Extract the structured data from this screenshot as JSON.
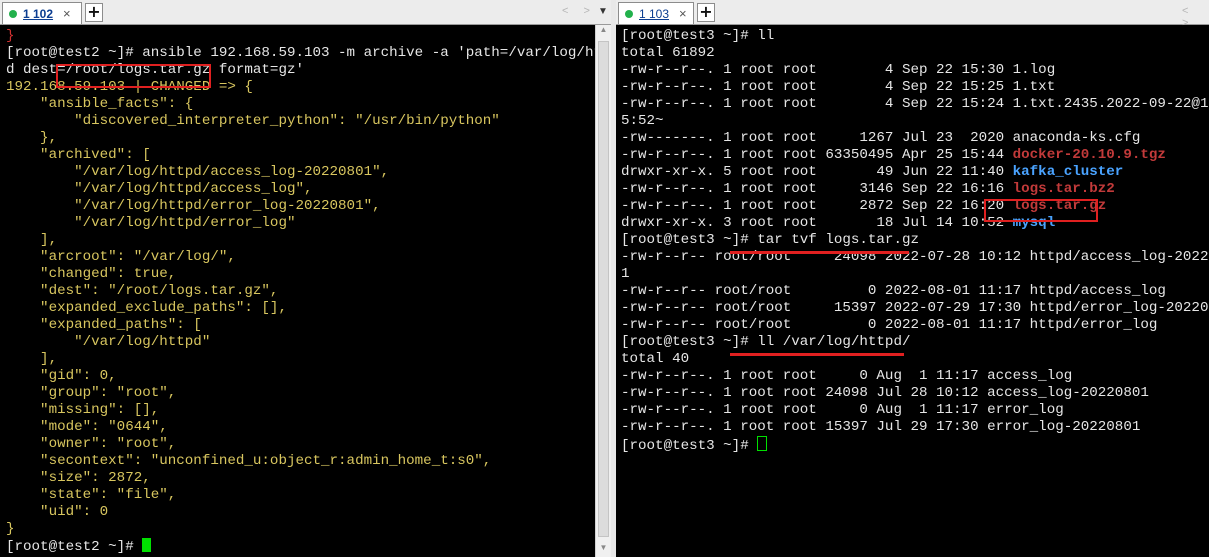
{
  "left": {
    "tab_label": "1 102",
    "tab_close": "×",
    "add_tab": "+",
    "nav_arrows": "< >",
    "menu_arrow": "▼",
    "lines": [
      [
        {
          "t": "}",
          "c": "r"
        }
      ],
      [
        {
          "t": "[root@test2 ~]# ansible 192.168.59.103 -m archive -a 'path=/var/log/http",
          "c": "w"
        }
      ],
      [
        {
          "t": "d dest=/root/logs.tar.gz format=gz'",
          "c": "w"
        }
      ],
      [
        {
          "t": "192.168.59.103 | CHANGED => {",
          "c": "y"
        }
      ],
      [
        {
          "t": "    \"ansible_facts\": {",
          "c": "y"
        }
      ],
      [
        {
          "t": "        \"discovered_interpreter_python\": \"/usr/bin/python\"",
          "c": "y"
        }
      ],
      [
        {
          "t": "    },",
          "c": "y"
        }
      ],
      [
        {
          "t": "    \"archived\": [",
          "c": "y"
        }
      ],
      [
        {
          "t": "        \"/var/log/httpd/access_log-20220801\",",
          "c": "y"
        }
      ],
      [
        {
          "t": "        \"/var/log/httpd/access_log\",",
          "c": "y"
        }
      ],
      [
        {
          "t": "        \"/var/log/httpd/error_log-20220801\",",
          "c": "y"
        }
      ],
      [
        {
          "t": "        \"/var/log/httpd/error_log\"",
          "c": "y"
        }
      ],
      [
        {
          "t": "    ],",
          "c": "y"
        }
      ],
      [
        {
          "t": "    \"arcroot\": \"/var/log/\",",
          "c": "y"
        }
      ],
      [
        {
          "t": "    \"changed\": true,",
          "c": "y"
        }
      ],
      [
        {
          "t": "    \"dest\": \"/root/logs.tar.gz\",",
          "c": "y"
        }
      ],
      [
        {
          "t": "    \"expanded_exclude_paths\": [],",
          "c": "y"
        }
      ],
      [
        {
          "t": "    \"expanded_paths\": [",
          "c": "y"
        }
      ],
      [
        {
          "t": "        \"/var/log/httpd\"",
          "c": "y"
        }
      ],
      [
        {
          "t": "    ],",
          "c": "y"
        }
      ],
      [
        {
          "t": "    \"gid\": 0,",
          "c": "y"
        }
      ],
      [
        {
          "t": "    \"group\": \"root\",",
          "c": "y"
        }
      ],
      [
        {
          "t": "    \"missing\": [],",
          "c": "y"
        }
      ],
      [
        {
          "t": "    \"mode\": \"0644\",",
          "c": "y"
        }
      ],
      [
        {
          "t": "    \"owner\": \"root\",",
          "c": "y"
        }
      ],
      [
        {
          "t": "    \"secontext\": \"unconfined_u:object_r:admin_home_t:s0\",",
          "c": "y"
        }
      ],
      [
        {
          "t": "    \"size\": 2872,",
          "c": "y"
        }
      ],
      [
        {
          "t": "    \"state\": \"file\",",
          "c": "y"
        }
      ],
      [
        {
          "t": "    \"uid\": 0",
          "c": "y"
        }
      ],
      [
        {
          "t": "}",
          "c": "y"
        }
      ],
      [
        {
          "t": "[root@test2 ~]# ",
          "c": "w"
        }
      ]
    ]
  },
  "right": {
    "tab_label": "1 103",
    "tab_close": "×",
    "add_tab": "+",
    "nav_arrows": "< >",
    "lines": [
      [
        {
          "t": "[root@test3 ~]# ll",
          "c": "w"
        }
      ],
      [
        {
          "t": "total 61892",
          "c": "w"
        }
      ],
      [
        {
          "t": "-rw-r--r--. 1 root root        4 Sep 22 15:30 1.log",
          "c": "w"
        }
      ],
      [
        {
          "t": "-rw-r--r--. 1 root root        4 Sep 22 15:25 1.txt",
          "c": "w"
        }
      ],
      [
        {
          "t": "-rw-r--r--. 1 root root        4 Sep 22 15:24 1.txt.2435.2022-09-22@15:2",
          "c": "w"
        }
      ],
      [
        {
          "t": "5:52~",
          "c": "w"
        }
      ],
      [
        {
          "t": "-rw-------. 1 root root     1267 Jul 23  2020 anaconda-ks.cfg",
          "c": "w"
        }
      ],
      [
        {
          "t": "-rw-r--r--. 1 root root 63350495 Apr 25 15:44 ",
          "c": "w"
        },
        {
          "t": "docker-20.10.9.tgz",
          "c": "db"
        }
      ],
      [
        {
          "t": "drwxr-xr-x. 5 root root       49 Jun 22 11:40 ",
          "c": "w"
        },
        {
          "t": "kafka_cluster",
          "c": "bb"
        }
      ],
      [
        {
          "t": "-rw-r--r--. 1 root root     3146 Sep 22 16:16 ",
          "c": "w"
        },
        {
          "t": "logs.tar.bz2",
          "c": "db"
        }
      ],
      [
        {
          "t": "-rw-r--r--. 1 root root     2872 Sep 22 16:20 ",
          "c": "w"
        },
        {
          "t": "logs.tar.gz",
          "c": "db"
        }
      ],
      [
        {
          "t": "drwxr-xr-x. 3 root root       18 Jul 14 10:52 ",
          "c": "w"
        },
        {
          "t": "mysql",
          "c": "bb"
        }
      ],
      [
        {
          "t": "[root@test3 ~]# tar tvf logs.tar.gz",
          "c": "w"
        }
      ],
      [
        {
          "t": "-rw-r--r-- root/root     24098 2022-07-28 10:12 httpd/access_log-2022080",
          "c": "w"
        }
      ],
      [
        {
          "t": "1",
          "c": "w"
        }
      ],
      [
        {
          "t": "-rw-r--r-- root/root         0 2022-08-01 11:17 httpd/access_log",
          "c": "w"
        }
      ],
      [
        {
          "t": "-rw-r--r-- root/root     15397 2022-07-29 17:30 httpd/error_log-20220801",
          "c": "w"
        }
      ],
      [
        {
          "t": "-rw-r--r-- root/root         0 2022-08-01 11:17 httpd/error_log",
          "c": "w"
        }
      ],
      [
        {
          "t": "[root@test3 ~]# ll /var/log/httpd/",
          "c": "w"
        }
      ],
      [
        {
          "t": "total 40",
          "c": "w"
        }
      ],
      [
        {
          "t": "-rw-r--r--. 1 root root     0 Aug  1 11:17 access_log",
          "c": "w"
        }
      ],
      [
        {
          "t": "-rw-r--r--. 1 root root 24098 Jul 28 10:12 access_log-20220801",
          "c": "w"
        }
      ],
      [
        {
          "t": "-rw-r--r--. 1 root root     0 Aug  1 11:17 error_log",
          "c": "w"
        }
      ],
      [
        {
          "t": "-rw-r--r--. 1 root root 15397 Jul 29 17:30 error_log-20220801",
          "c": "w"
        }
      ],
      [
        {
          "t": "[root@test3 ~]# ",
          "c": "w"
        }
      ]
    ]
  }
}
